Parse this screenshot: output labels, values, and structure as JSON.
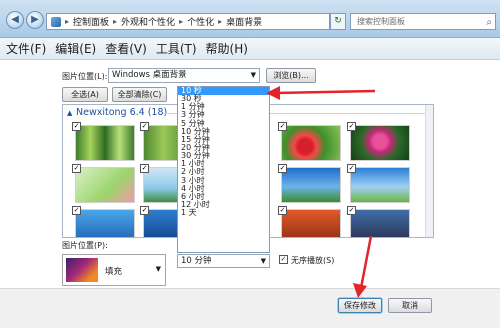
{
  "address_bar": {
    "breadcrumbs": [
      "控制面板",
      "外观和个性化",
      "个性化",
      "桌面背景"
    ],
    "search_placeholder": "搜索控制面板"
  },
  "menu": [
    "文件(F)",
    "编辑(E)",
    "查看(V)",
    "工具(T)",
    "帮助(H)"
  ],
  "location": {
    "label": "图片位置(L):",
    "value": "Windows 桌面背景",
    "browse_label": "浏览(B)..."
  },
  "selection_buttons": {
    "select_all": "全选(A)",
    "clear_all": "全部清除(C)"
  },
  "gallery": {
    "group_title": "Newxitong 6.4 (18)"
  },
  "interval_options": [
    "10 秒",
    "30 秒",
    "1 分钟",
    "3 分钟",
    "5 分钟",
    "10 分钟",
    "15 分钟",
    "20 分钟",
    "30 分钟",
    "1 小时",
    "2 小时",
    "3 小时",
    "4 小时",
    "6 小时",
    "12 小时",
    "1 天"
  ],
  "interval_selected_value": "10 分钟",
  "picture_position": {
    "label": "图片位置(P):",
    "value": "填充"
  },
  "shuffle_label": "无序播放(S)",
  "buttons": {
    "save": "保存修改",
    "cancel": "取消"
  },
  "colors": {
    "highlight": "#3399ff",
    "annotation_arrow": "#e3242b"
  }
}
